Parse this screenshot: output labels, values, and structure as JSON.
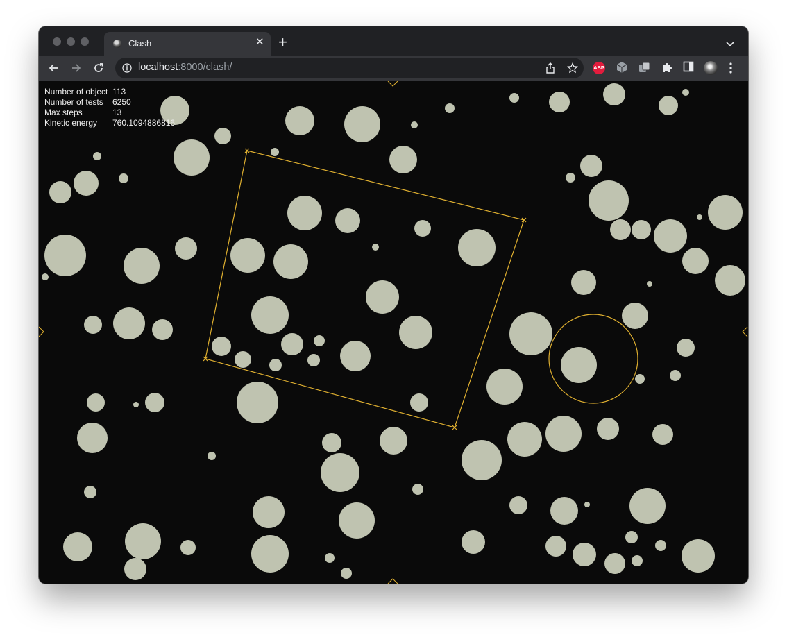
{
  "browser": {
    "tab_title": "Clash",
    "url_host": "localhost",
    "url_rest": ":8000/clash/",
    "extension_abp_label": "ABP",
    "icons": [
      "back-arrow-icon",
      "forward-arrow-icon",
      "reload-icon",
      "info-icon",
      "share-icon",
      "bookmark-star-icon",
      "puzzle-icon",
      "sidebar-icon",
      "kebab-menu-icon"
    ]
  },
  "stats": [
    {
      "label": "Number of object",
      "value": "113"
    },
    {
      "label": "Number of tests",
      "value": "6250"
    },
    {
      "label": "Max steps",
      "value": "13"
    },
    {
      "label": "Kinetic energy",
      "value": "760.1094886816"
    }
  ],
  "colors": {
    "background": "#0a0a0a",
    "ball": "#bfc3b0",
    "query_outline": "#e0b030",
    "tab_bg": "#35363a",
    "titlebar_bg": "#202124"
  }
}
